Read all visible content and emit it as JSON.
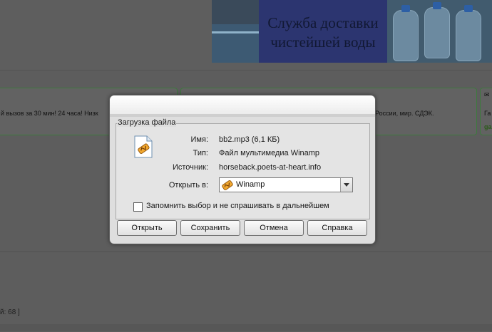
{
  "banner": {
    "line1": "Служба доставки",
    "line2": "чистейшей воды"
  },
  "background": {
    "box1_text": "й вызов за 30 мин! 24 часа! Низк",
    "box2_text": "России, мир. СДЭК.",
    "box3_text": "Га",
    "box3_link": "ga",
    "counter_text": "й: 68 ]"
  },
  "dialog": {
    "title": "Загрузка файла",
    "file_icon": "winamp-file-icon",
    "name_label": "Имя:",
    "name_value": "bb2.mp3 (6,1 КБ)",
    "type_label": "Тип:",
    "type_value": "Файл мультимедиа Winamp",
    "source_label": "Источник:",
    "source_value": "horseback.poets-at-heart.info",
    "open_in_label": "Открыть в:",
    "open_in_value": "Winamp",
    "remember_label": "Запомнить выбор и не спрашивать в дальнейшем",
    "remember_checked": false,
    "buttons": {
      "open": "Открыть",
      "save": "Сохранить",
      "cancel": "Отмена",
      "help": "Справка"
    }
  },
  "colors": {
    "overlay_dim": "#5f5f5f",
    "dialog_bg": "#dedede",
    "green_border": "#3d7a3d",
    "banner_blue": "#2c3570"
  }
}
